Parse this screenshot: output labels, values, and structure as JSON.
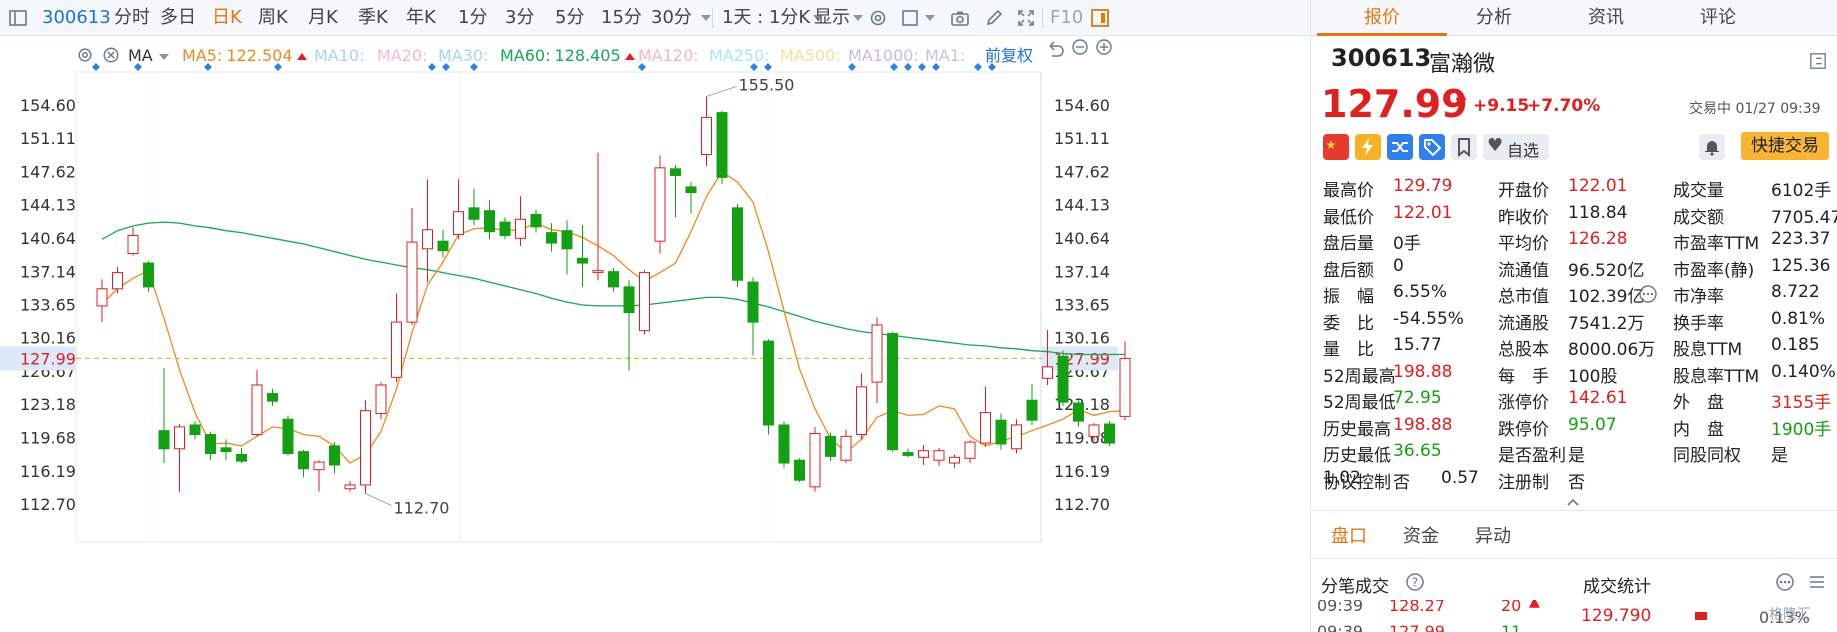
{
  "toolbar": {
    "code": "300613",
    "periods": [
      "分时",
      "多日",
      "日K",
      "周K",
      "月K",
      "季K",
      "年K",
      "1分",
      "3分",
      "5分",
      "15分",
      "30分"
    ],
    "active_period": "日K",
    "interval": "1天 : 1分K",
    "display": "显示",
    "f10": "F10"
  },
  "ma_bar": {
    "type": "MA",
    "items": [
      {
        "label": "MA5:",
        "value": "122.504",
        "color": "#f08a1e",
        "arrow": true
      },
      {
        "label": "MA10:",
        "value": "",
        "color": "#a9d3f5",
        "arrow": false
      },
      {
        "label": "MA20:",
        "value": "",
        "color": "#f5b8d3",
        "arrow": false
      },
      {
        "label": "MA30:",
        "value": "",
        "color": "#a9d3f5",
        "arrow": false
      },
      {
        "label": "MA60:",
        "value": "128.405",
        "color": "#18a65a",
        "arrow": true
      },
      {
        "label": "MA120:",
        "value": "",
        "color": "#f5b8c3",
        "arrow": false
      },
      {
        "label": "MA250:",
        "value": "",
        "color": "#a9e6f5",
        "arrow": false
      },
      {
        "label": "MA500:",
        "value": "",
        "color": "#f5e0a0",
        "arrow": false
      },
      {
        "label": "MA1000:",
        "value": "",
        "color": "#c8b8f0",
        "arrow": false
      },
      {
        "label": "MA1:",
        "value": "",
        "color": "#c0c8d0",
        "arrow": false
      }
    ],
    "adjust": "前复权"
  },
  "chart_data": {
    "type": "candlestick",
    "y_ticks": [
      "154.60",
      "151.11",
      "147.62",
      "144.13",
      "140.64",
      "137.14",
      "133.65",
      "130.16",
      "126.67",
      "123.18",
      "119.68",
      "116.19",
      "112.70"
    ],
    "ylim": [
      112.7,
      154.6
    ],
    "current_price": "127.99",
    "high_marker": "155.50",
    "low_marker": "112.70",
    "colors": {
      "up": "#e02020",
      "down": "#13a013",
      "ma5": "#f08a1e",
      "ma60": "#18a65a"
    },
    "candles": [
      [
        133.5,
        135.3,
        131.8,
        136.3
      ],
      [
        135.3,
        137.0,
        134.8,
        137.6
      ],
      [
        139.0,
        140.9,
        138.8,
        141.8
      ],
      [
        138.0,
        135.5,
        135.0,
        138.2
      ],
      [
        120.4,
        118.5,
        117.0,
        127.0
      ],
      [
        118.5,
        120.8,
        114.0,
        121.1
      ],
      [
        121.0,
        120.0,
        119.5,
        121.4
      ],
      [
        120.0,
        118.0,
        117.3,
        120.3
      ],
      [
        118.6,
        118.2,
        117.3,
        119.5
      ],
      [
        117.9,
        117.2,
        117.0,
        118.6
      ],
      [
        120.0,
        125.2,
        119.8,
        126.8
      ],
      [
        124.3,
        123.5,
        123.0,
        124.8
      ],
      [
        121.6,
        118.0,
        117.8,
        122.0
      ],
      [
        118.2,
        116.4,
        115.5,
        118.4
      ],
      [
        116.3,
        117.1,
        114.0,
        117.3
      ],
      [
        118.8,
        116.8,
        115.9,
        119.2
      ],
      [
        114.3,
        114.7,
        114.0,
        115.1
      ],
      [
        114.7,
        122.5,
        113.8,
        123.6
      ],
      [
        122.2,
        125.2,
        121.6,
        125.5
      ],
      [
        126.0,
        131.8,
        125.5,
        134.8
      ],
      [
        131.8,
        140.2,
        131.5,
        143.8
      ],
      [
        139.5,
        141.5,
        136.0,
        146.8
      ],
      [
        140.3,
        139.3,
        138.6,
        141.5
      ],
      [
        141.0,
        143.4,
        140.5,
        146.8
      ],
      [
        143.8,
        142.6,
        142.0,
        145.8
      ],
      [
        143.5,
        141.3,
        140.5,
        144.6
      ],
      [
        142.3,
        140.9,
        140.5,
        142.8
      ],
      [
        140.6,
        142.6,
        139.8,
        145.0
      ],
      [
        143.1,
        141.8,
        141.2,
        143.6
      ],
      [
        141.2,
        140.1,
        139.2,
        142.2
      ],
      [
        141.4,
        139.5,
        136.8,
        142.5
      ],
      [
        138.5,
        138.0,
        135.5,
        142.0
      ],
      [
        137.0,
        137.2,
        136.2,
        149.6
      ],
      [
        137.1,
        135.5,
        135.0,
        137.5
      ],
      [
        135.5,
        132.8,
        126.7,
        136.2
      ],
      [
        130.9,
        137.0,
        130.5,
        137.3
      ],
      [
        140.3,
        148.0,
        139.0,
        149.3
      ],
      [
        147.9,
        147.2,
        142.8,
        148.3
      ],
      [
        146.0,
        145.4,
        143.2,
        146.5
      ],
      [
        149.4,
        153.3,
        148.2,
        155.5
      ],
      [
        153.8,
        147.0,
        146.3,
        154.0
      ],
      [
        143.8,
        136.2,
        135.5,
        144.2
      ],
      [
        136.0,
        131.8,
        128.3,
        136.5
      ],
      [
        129.8,
        121.0,
        120.0,
        130.0
      ],
      [
        121.0,
        117.0,
        116.5,
        121.4
      ],
      [
        117.3,
        115.2,
        115.0,
        117.5
      ],
      [
        114.5,
        120.1,
        114.0,
        120.8
      ],
      [
        119.8,
        117.7,
        117.2,
        120.2
      ],
      [
        117.3,
        119.8,
        117.0,
        120.5
      ],
      [
        120.0,
        125.0,
        119.5,
        126.4
      ],
      [
        125.5,
        131.5,
        123.3,
        132.3
      ],
      [
        130.6,
        118.4,
        118.2,
        130.8
      ],
      [
        118.1,
        117.8,
        117.6,
        118.5
      ],
      [
        117.6,
        118.3,
        116.8,
        118.9
      ],
      [
        117.3,
        118.3,
        116.7,
        118.6
      ],
      [
        117.0,
        117.6,
        116.5,
        117.9
      ],
      [
        117.5,
        119.2,
        117.0,
        119.4
      ],
      [
        119.1,
        122.3,
        118.8,
        125.0
      ],
      [
        121.5,
        119.0,
        118.4,
        122.2
      ],
      [
        118.5,
        121.0,
        118.0,
        121.6
      ],
      [
        123.6,
        121.5,
        121.0,
        125.3
      ],
      [
        125.9,
        127.1,
        125.2,
        131.0
      ],
      [
        128.2,
        123.4,
        123.0,
        128.8
      ],
      [
        123.3,
        121.4,
        120.8,
        123.6
      ],
      [
        119.8,
        121.0,
        119.3,
        121.2
      ],
      [
        121.1,
        119.1,
        118.8,
        121.4
      ],
      [
        121.9,
        127.99,
        121.5,
        129.79
      ]
    ],
    "ma5": [
      133.7,
      135.3,
      136.4,
      137.2,
      132.2,
      126.8,
      122.3,
      119.0,
      119.1,
      118.8,
      119.8,
      120.8,
      120.6,
      120.0,
      119.8,
      118.8,
      117.0,
      117.9,
      120.3,
      124.8,
      130.7,
      135.7,
      138.1,
      141.0,
      141.6,
      141.7,
      141.4,
      141.5,
      142.2,
      141.5,
      141.3,
      140.7,
      139.8,
      138.8,
      137.3,
      136.1,
      137.0,
      138.0,
      141.3,
      145.0,
      147.6,
      146.5,
      144.4,
      139.2,
      133.0,
      126.9,
      122.7,
      119.6,
      118.1,
      119.5,
      121.8,
      122.5,
      122.0,
      122.1,
      123.0,
      122.7,
      119.8,
      118.8,
      119.3,
      119.8,
      120.4,
      121.0,
      121.6,
      122.6,
      122.0,
      122.4,
      122.5
    ],
    "ma60": [
      140.5,
      141.4,
      141.9,
      142.2,
      142.3,
      142.2,
      141.9,
      141.7,
      141.4,
      141.2,
      140.9,
      140.6,
      140.3,
      140.0,
      139.6,
      139.2,
      138.8,
      138.4,
      138.1,
      137.8,
      137.5,
      137.3,
      137.0,
      136.7,
      136.4,
      136.0,
      135.6,
      135.2,
      134.8,
      134.3,
      133.9,
      133.6,
      133.5,
      133.5,
      133.5,
      133.6,
      133.8,
      134.0,
      134.2,
      134.4,
      134.4,
      134.2,
      133.8,
      133.4,
      132.9,
      132.4,
      131.9,
      131.5,
      131.1,
      130.8,
      130.6,
      130.4,
      130.2,
      130.0,
      129.8,
      129.6,
      129.4,
      129.3,
      129.1,
      129.0,
      128.8,
      128.7,
      128.5,
      128.4,
      128.4,
      128.4,
      128.405
    ]
  },
  "quote": {
    "code": "300613",
    "name": "富瀚微",
    "price": "127.99",
    "change": "+9.15",
    "pct": "+7.70%",
    "status": "交易中 01/27 09:39",
    "watch_label": "自选",
    "trade_label": "快捷交易",
    "rows": [
      [
        [
          "最高价",
          "129.79",
          "red"
        ],
        [
          "开盘价",
          "122.01",
          "red"
        ],
        [
          "成交量",
          "6102手",
          "blk"
        ]
      ],
      [
        [
          "最低价",
          "122.01",
          "red"
        ],
        [
          "昨收价",
          "118.84",
          "blk"
        ],
        [
          "成交额",
          "7705.47万",
          "blk"
        ]
      ],
      [
        [
          "盘后量",
          "0手",
          "blk"
        ],
        [
          "平均价",
          "126.28",
          "red"
        ],
        [
          "市盈率TTM",
          "223.37",
          "blk"
        ]
      ],
      [
        [
          "盘后额",
          "0",
          "blk"
        ],
        [
          "流通值",
          "96.520亿",
          "blk"
        ],
        [
          "市盈率(静)",
          "125.36",
          "blk"
        ]
      ],
      [
        [
          "振　幅",
          "6.55%",
          "blk"
        ],
        [
          "总市值",
          "102.39亿",
          "blk"
        ],
        [
          "市净率",
          "8.722",
          "blk"
        ]
      ],
      [
        [
          "委　比",
          "-54.55%",
          "blk"
        ],
        [
          "流通股",
          "7541.2万",
          "blk"
        ],
        [
          "换手率",
          "0.81%",
          "blk"
        ]
      ],
      [
        [
          "量　比",
          "15.77",
          "blk"
        ],
        [
          "总股本",
          "8000.06万",
          "blk"
        ],
        [
          "股息TTM",
          "0.185",
          "blk"
        ]
      ],
      [
        [
          "52周最高",
          "198.88",
          "red"
        ],
        [
          "每　手",
          "100股",
          "blk"
        ],
        [
          "股息率TTM",
          "0.140%",
          "blk"
        ]
      ],
      [
        [
          "52周最低",
          "72.95",
          "green"
        ],
        [
          "涨停价",
          "142.61",
          "red"
        ],
        [
          "外　盘",
          "3155手",
          "red"
        ]
      ],
      [
        [
          "历史最高",
          "198.88",
          "red"
        ],
        [
          "跌停价",
          "95.07",
          "green"
        ],
        [
          "内　盘",
          "1900手",
          "green"
        ]
      ],
      [
        [
          "历史最低",
          "36.65",
          "green"
        ],
        [
          "是否盈利",
          "是",
          "blk"
        ],
        [
          "同股同权",
          "是",
          "blk"
        ]
      ],
      [
        [
          "协议控制",
          "否",
          "blk"
        ],
        [
          "注册制",
          "否",
          "blk"
        ],
        [
          "1.02",
          "0.57",
          "blk"
        ]
      ]
    ]
  },
  "panel_tabs": [
    "报价",
    "分析",
    "资讯",
    "评论"
  ],
  "bottom_tabs": [
    "盘口",
    "资金",
    "异动"
  ],
  "trades": {
    "title_left": "分笔成交",
    "title_right": "成交统计",
    "row1": [
      "09:39",
      "128.27",
      "20"
    ],
    "row2": [
      "09:39",
      "127.99",
      "11"
    ],
    "stat_price": "129.790",
    "stat_pct": "0.13%"
  },
  "watermark": "格隆汇"
}
